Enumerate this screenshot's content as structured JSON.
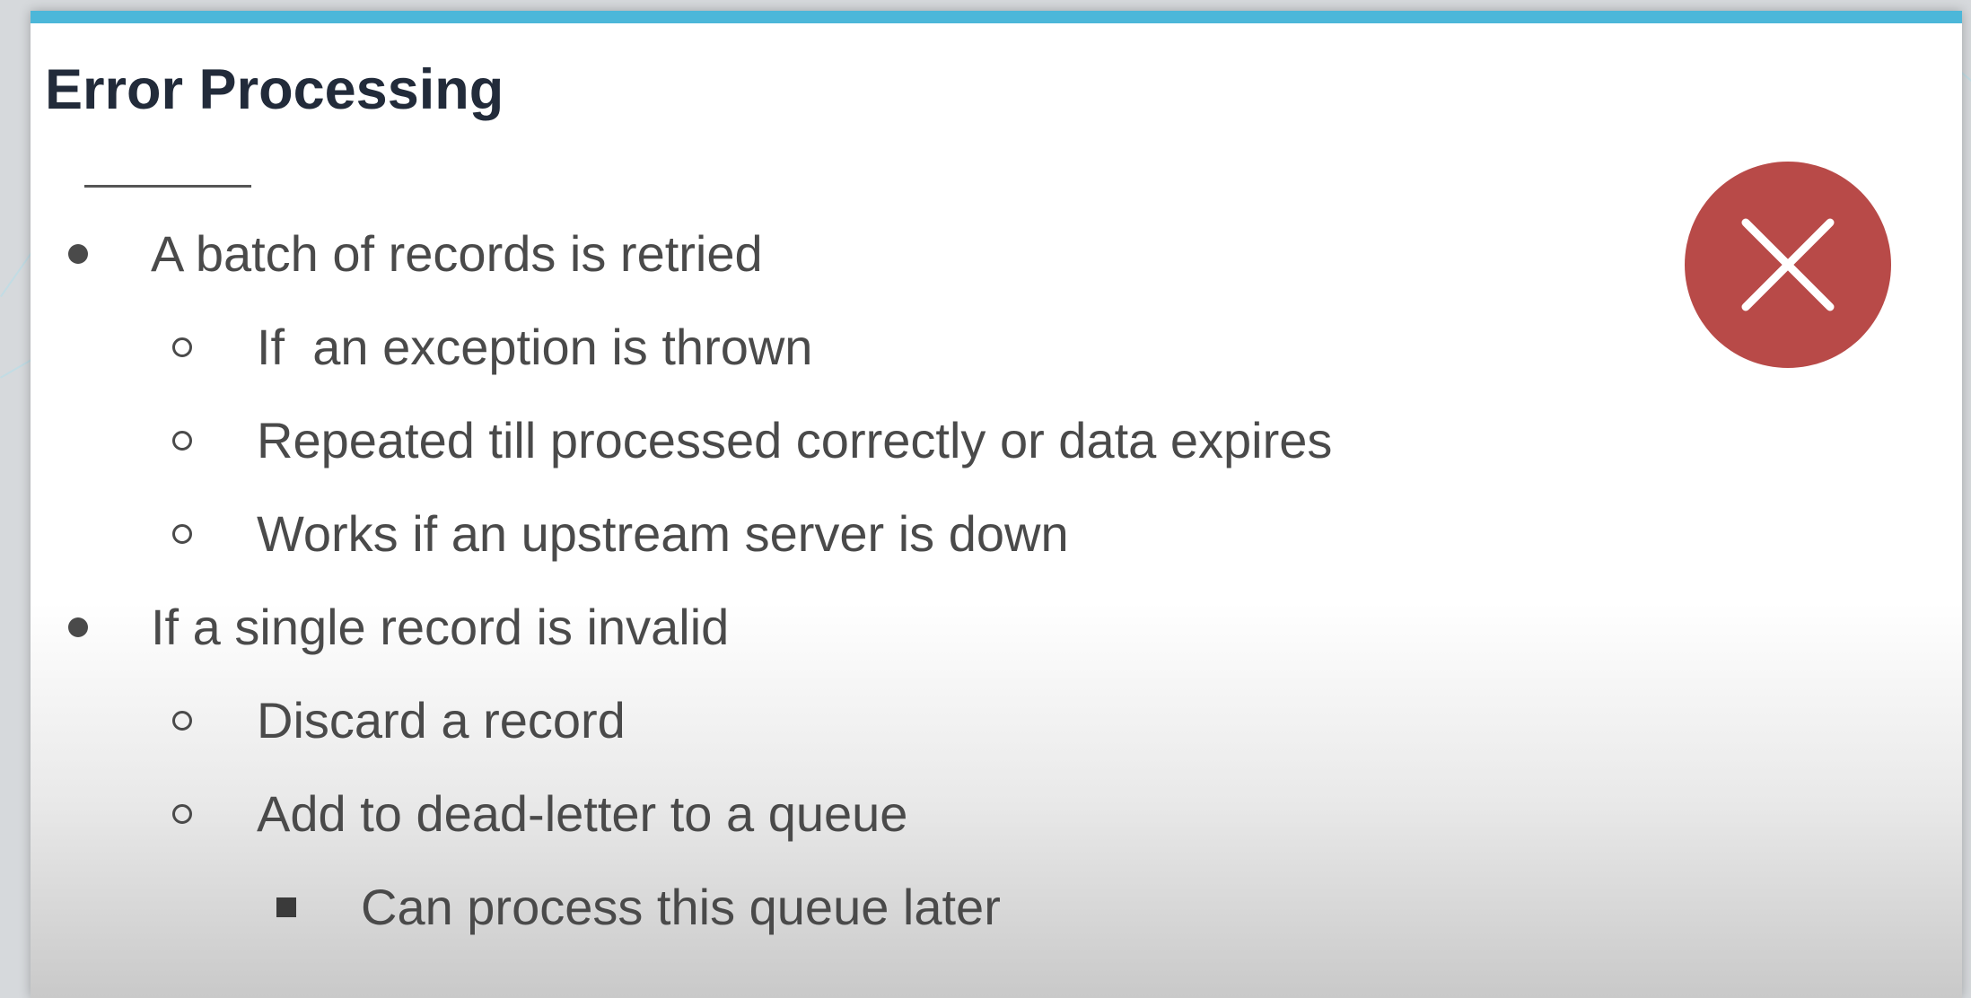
{
  "slide": {
    "title": "Error Processing",
    "colors": {
      "accent_bar": "#4cb7d9",
      "badge": "#b84a48",
      "text": "#4a4a4a",
      "title": "#222b3a"
    },
    "badge_icon": "close-x-icon",
    "bullets": [
      {
        "level": 1,
        "text": "A batch of records is retried"
      },
      {
        "level": 2,
        "text": "If  an exception is thrown"
      },
      {
        "level": 2,
        "text": "Repeated till processed correctly or data expires"
      },
      {
        "level": 2,
        "text": "Works if an upstream server is down"
      },
      {
        "level": 1,
        "text": "If a single record is invalid"
      },
      {
        "level": 2,
        "text": "Discard a record"
      },
      {
        "level": 2,
        "text": "Add to dead-letter to a queue"
      },
      {
        "level": 3,
        "text": "Can process this queue later"
      }
    ]
  }
}
